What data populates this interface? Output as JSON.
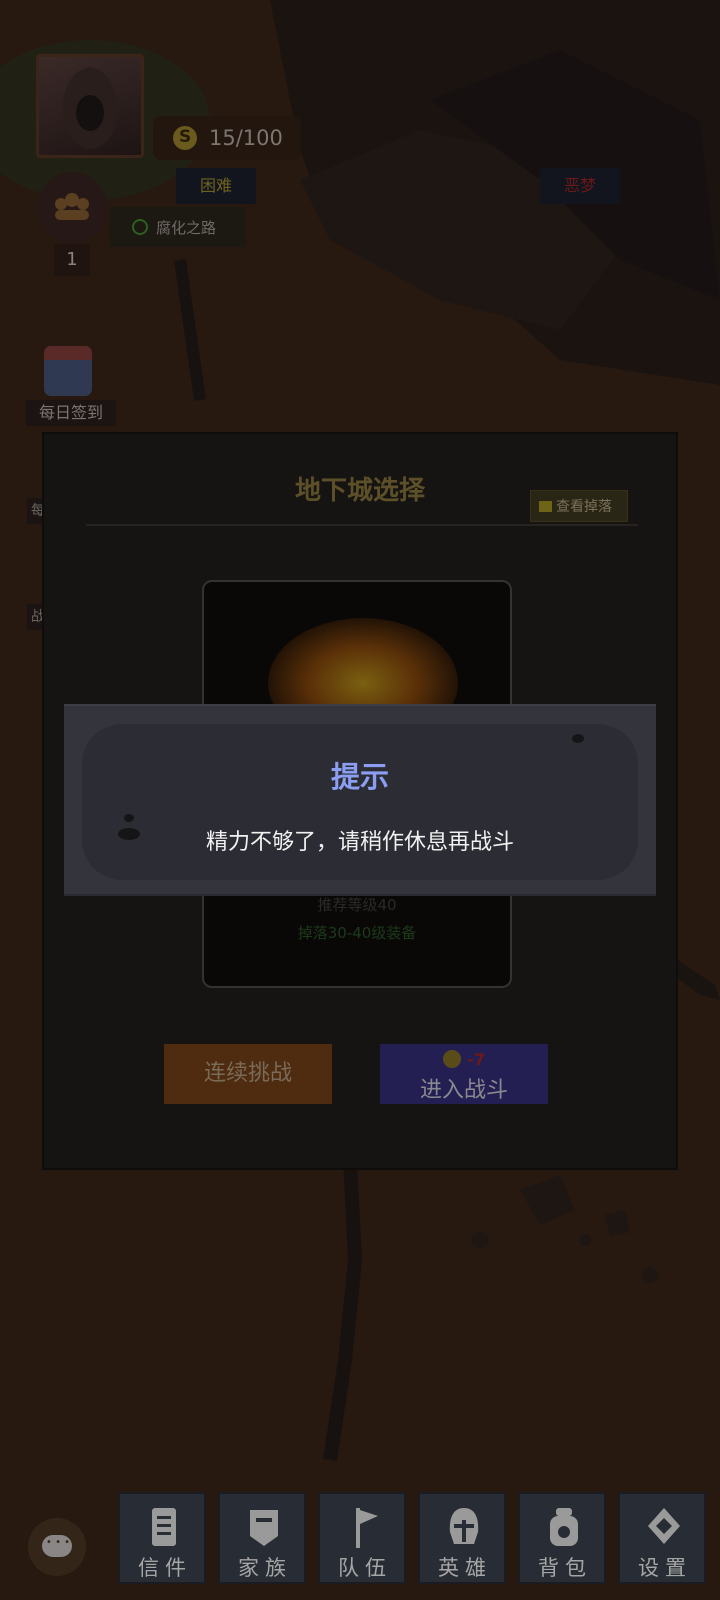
{
  "hud": {
    "energy": "15/100",
    "team_count": "1",
    "route_name": "腐化之路",
    "daily_signin": "每日签到",
    "side_tag_1": "每",
    "side_tag_2": "战"
  },
  "dungeon": {
    "title": "地下城选择",
    "view_drops": "查看掉落",
    "difficulty_left": "困难",
    "difficulty_right": "恶梦",
    "card_level": "推荐等级40",
    "card_drops": "掉落30-40级装备",
    "continuous_button": "连续挑战",
    "enter_button": "进入战斗",
    "enter_cost": "-7"
  },
  "tip": {
    "title": "提示",
    "message": "精力不够了，请稍作休息再战斗"
  },
  "nav": [
    {
      "label": "信件",
      "icon": "mail-scroll-icon"
    },
    {
      "label": "家族",
      "icon": "family-banner-icon"
    },
    {
      "label": "队伍",
      "icon": "team-flag-icon"
    },
    {
      "label": "英雄",
      "icon": "hero-helmet-icon"
    },
    {
      "label": "背包",
      "icon": "backpack-icon"
    },
    {
      "label": "设置",
      "icon": "settings-diamond-icon"
    }
  ],
  "colors": {
    "tip_title": "#8c9ef2",
    "tip_bg": "#34353c",
    "continuous_btn": "#4f2c10",
    "enter_btn": "#231f52"
  }
}
